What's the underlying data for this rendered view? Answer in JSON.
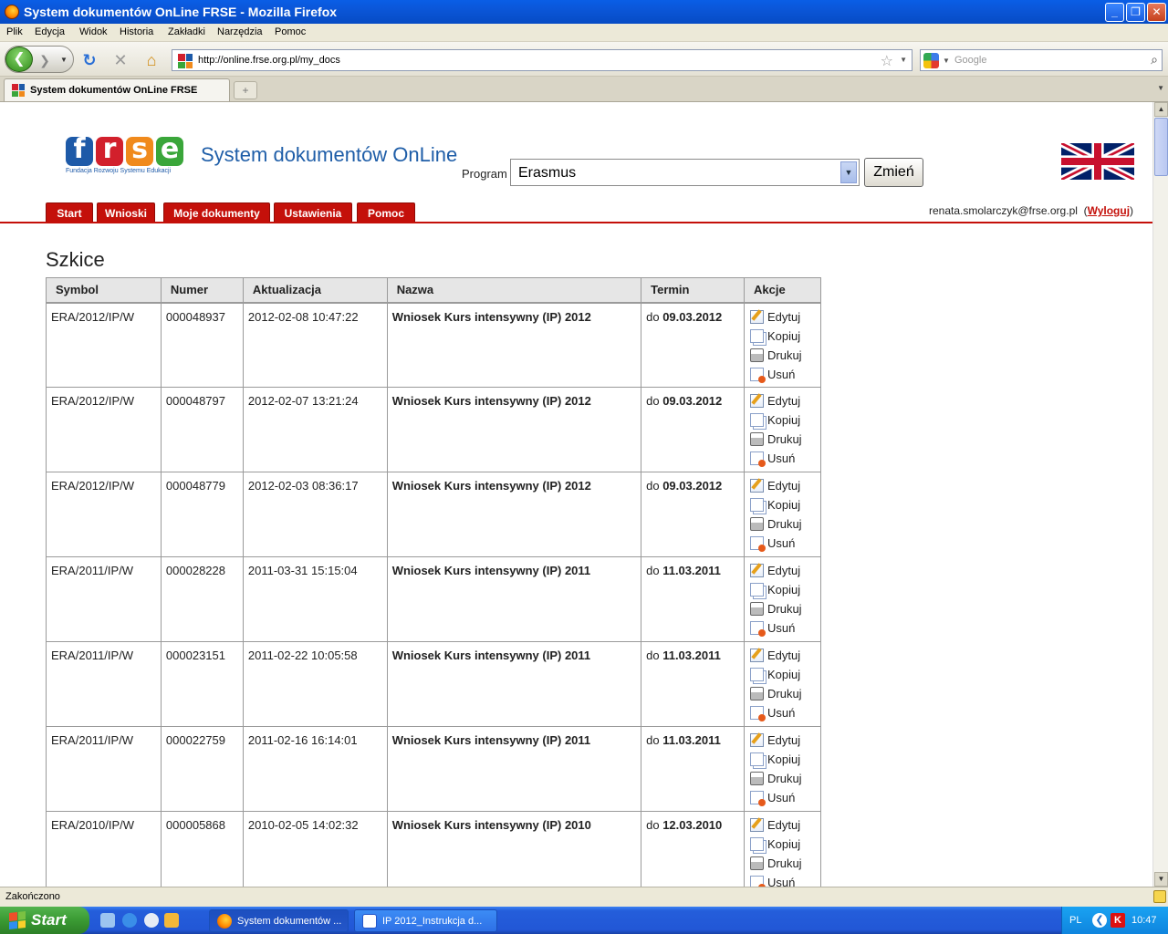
{
  "window": {
    "title": "System dokumentów OnLine FRSE - Mozilla Firefox"
  },
  "menu": [
    "Plik",
    "Edycja",
    "Widok",
    "Historia",
    "Zakładki",
    "Narzędzia",
    "Pomoc"
  ],
  "address": {
    "url": "http://online.frse.org.pl/my_docs"
  },
  "search": {
    "placeholder": "Google"
  },
  "tab": {
    "label": "System dokumentów OnLine FRSE",
    "new_tab": "+"
  },
  "logo": {
    "letters": [
      "f",
      "r",
      "s",
      "e"
    ],
    "subtitle": "Fundacja Rozwoju Systemu Edukacji"
  },
  "site": {
    "title": "System dokumentów OnLine",
    "program_label": "Program",
    "program_value": "Erasmus",
    "change_button": "Zmień"
  },
  "nav_tabs": [
    "Start",
    "Wnioski",
    "Moje dokumenty",
    "Ustawienia",
    "Pomoc"
  ],
  "user": {
    "email": "renata.smolarczyk@frse.org.pl",
    "logout": "Wyloguj"
  },
  "page_heading": "Szkice",
  "table": {
    "columns": [
      "Symbol",
      "Numer",
      "Aktualizacja",
      "Nazwa",
      "Termin",
      "Akcje"
    ],
    "actions": [
      "Edytuj",
      "Kopiuj",
      "Drukuj",
      "Usuń"
    ],
    "deadline_prefix": "do",
    "rows": [
      {
        "symbol": "ERA/2012/IP/W",
        "number": "000048937",
        "updated": "2012-02-08 10:47:22",
        "name": "Wniosek Kurs intensywny (IP) 2012",
        "deadline": "09.03.2012"
      },
      {
        "symbol": "ERA/2012/IP/W",
        "number": "000048797",
        "updated": "2012-02-07 13:21:24",
        "name": "Wniosek Kurs intensywny (IP) 2012",
        "deadline": "09.03.2012"
      },
      {
        "symbol": "ERA/2012/IP/W",
        "number": "000048779",
        "updated": "2012-02-03 08:36:17",
        "name": "Wniosek Kurs intensywny (IP) 2012",
        "deadline": "09.03.2012"
      },
      {
        "symbol": "ERA/2011/IP/W",
        "number": "000028228",
        "updated": "2011-03-31 15:15:04",
        "name": "Wniosek Kurs intensywny (IP) 2011",
        "deadline": "11.03.2011"
      },
      {
        "symbol": "ERA/2011/IP/W",
        "number": "000023151",
        "updated": "2011-02-22 10:05:58",
        "name": "Wniosek Kurs intensywny (IP) 2011",
        "deadline": "11.03.2011"
      },
      {
        "symbol": "ERA/2011/IP/W",
        "number": "000022759",
        "updated": "2011-02-16 16:14:01",
        "name": "Wniosek Kurs intensywny (IP) 2011",
        "deadline": "11.03.2011"
      },
      {
        "symbol": "ERA/2010/IP/W",
        "number": "000005868",
        "updated": "2010-02-05 14:02:32",
        "name": "Wniosek Kurs intensywny (IP) 2010",
        "deadline": "12.03.2010"
      }
    ]
  },
  "status": "Zakończono",
  "taskbar": {
    "start": "Start",
    "items": [
      "System dokumentów ...",
      "IP 2012_Instrukcja d..."
    ],
    "lang": "PL",
    "clock": "10:47"
  },
  "colors": {
    "brand_red": "#c4100a",
    "brand_blue": "#1f5ea8",
    "logo_blue": "#1e5aa8",
    "logo_red": "#d2202c",
    "logo_orange": "#f08a1c",
    "logo_green": "#3aa63a"
  }
}
